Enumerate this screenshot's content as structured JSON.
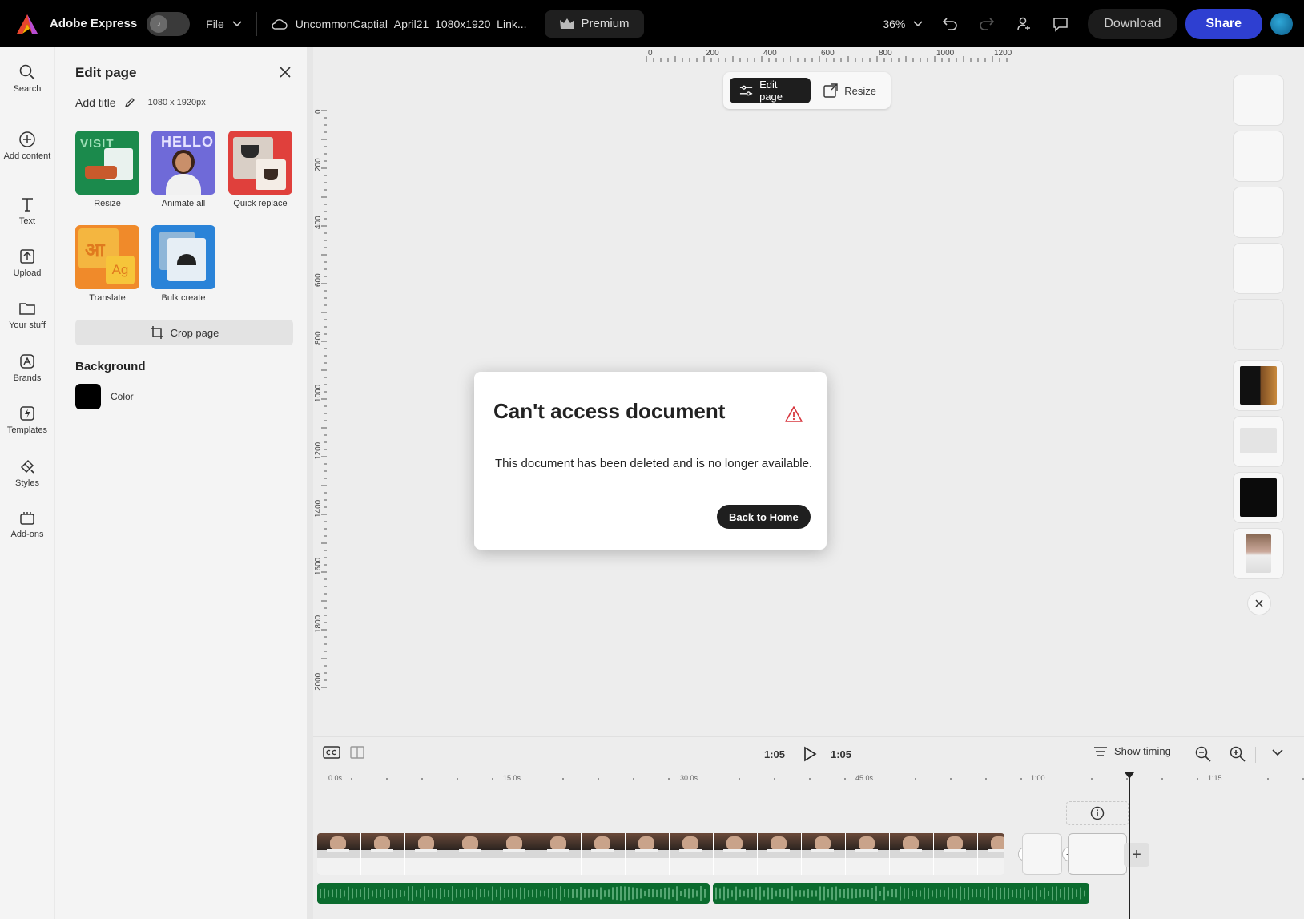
{
  "topbar": {
    "app_name": "Adobe Express",
    "file_menu": "File",
    "doc_name": "UncommonCaptial_April21_1080x1920_Link...",
    "premium": "Premium",
    "zoom": "36%",
    "download": "Download",
    "share": "Share"
  },
  "rail": [
    {
      "label": "Search",
      "icon": "search-icon"
    },
    {
      "label": "Add content",
      "icon": "plus-circle-icon"
    },
    {
      "label": "Text",
      "icon": "text-icon"
    },
    {
      "label": "Upload",
      "icon": "upload-icon"
    },
    {
      "label": "Your stuff",
      "icon": "folder-icon"
    },
    {
      "label": "Brands",
      "icon": "brands-icon"
    },
    {
      "label": "Templates",
      "icon": "templates-icon"
    },
    {
      "label": "Styles",
      "icon": "styles-icon"
    },
    {
      "label": "Add-ons",
      "icon": "add-ons-icon"
    }
  ],
  "panel": {
    "title": "Edit page",
    "add_title": "Add title",
    "dims": "1080 x 1920px",
    "tiles": [
      {
        "label": "Resize",
        "tile_text": "VISIT"
      },
      {
        "label": "Animate all",
        "tile_text": "HELLO"
      },
      {
        "label": "Quick replace",
        "tile_text": ""
      },
      {
        "label": "Translate",
        "tile_text_a": "आ",
        "tile_text_b": "Ag"
      },
      {
        "label": "Bulk create",
        "tile_text": ""
      }
    ],
    "crop": "Crop page",
    "background_title": "Background",
    "background_label": "Color"
  },
  "canvas_toolbar": {
    "edit_page": "Edit page",
    "resize": "Resize"
  },
  "ruler": {
    "top": [
      "0",
      "200",
      "400",
      "600",
      "800",
      "1000",
      "1200"
    ],
    "left": [
      "0",
      "200",
      "400",
      "600",
      "800",
      "1000",
      "1200",
      "1400",
      "1600",
      "1800",
      "2000"
    ]
  },
  "dialog": {
    "title": "Can't access document",
    "body": "This document has been deleted and is no longer available.",
    "button": "Back to Home"
  },
  "timeline": {
    "time_current": "1:05",
    "time_total": "1:05",
    "show_timing": "Show timing",
    "ticks": [
      "0.0s",
      "15.0s",
      "30.0s",
      "45.0s",
      "1:00",
      "1:15"
    ]
  },
  "colors": {
    "share": "#2e3fd1",
    "audio": "#0b6b2e",
    "warning": "#d7373f"
  }
}
